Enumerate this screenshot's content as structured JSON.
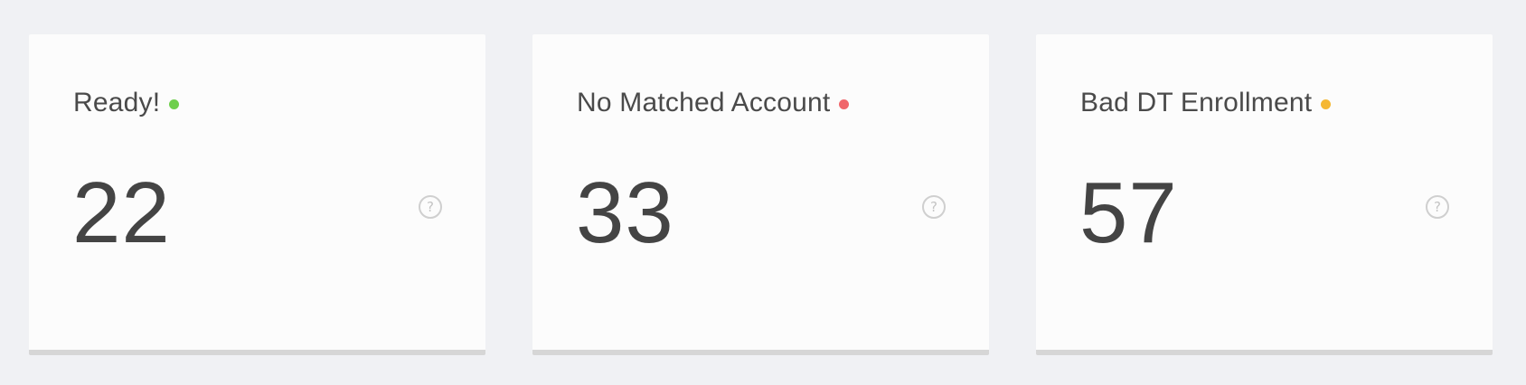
{
  "cards": [
    {
      "label": "Ready!",
      "value": "22",
      "status_color": "#6ecf4c",
      "help_icon": "question-circle-icon",
      "help_glyph": "?"
    },
    {
      "label": "No Matched Account",
      "value": "33",
      "status_color": "#f0666b",
      "help_icon": "question-circle-icon",
      "help_glyph": "?"
    },
    {
      "label": "Bad DT Enrollment",
      "value": "57",
      "status_color": "#f5b733",
      "help_icon": "question-circle-icon",
      "help_glyph": "?"
    }
  ]
}
